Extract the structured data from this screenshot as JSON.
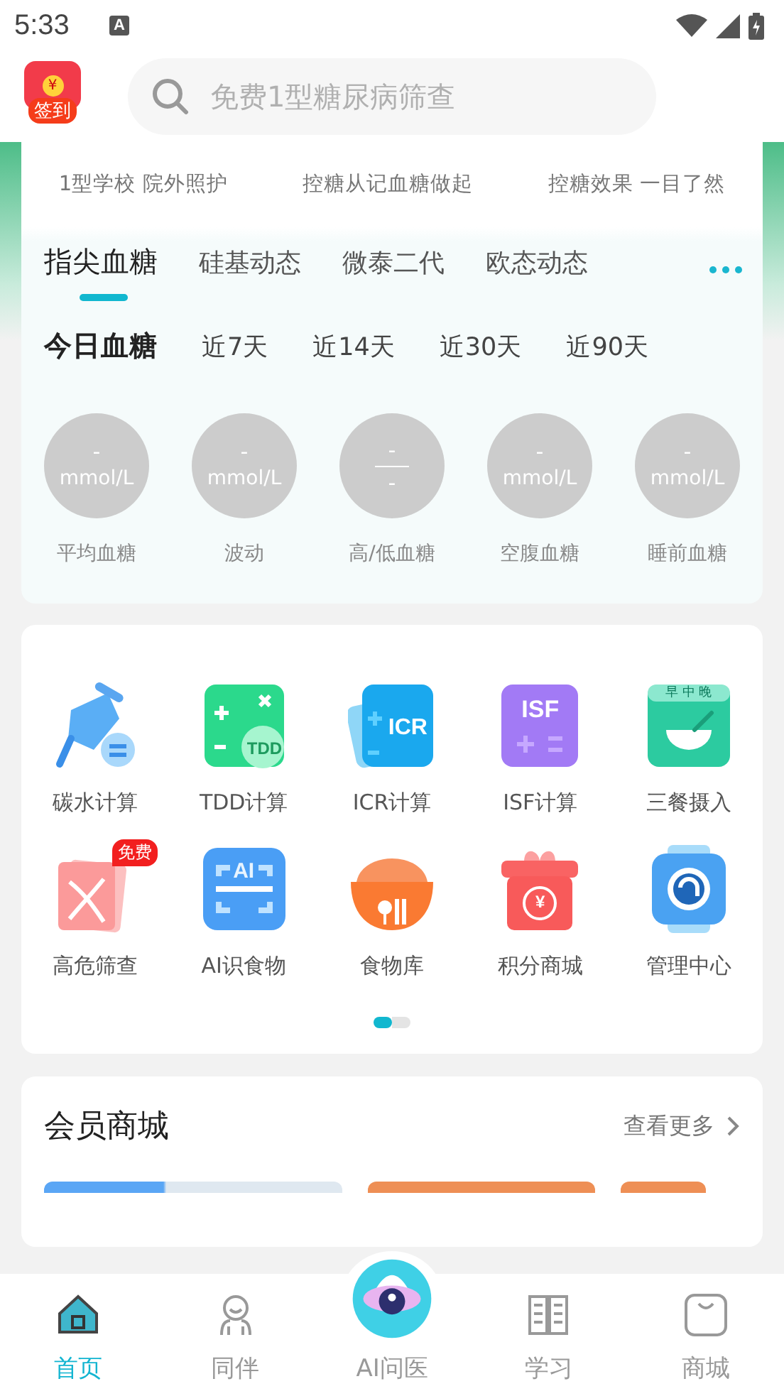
{
  "status_bar": {
    "time": "5:33",
    "notice_letter": "A"
  },
  "header": {
    "signin": {
      "label": "签到",
      "coin": "¥"
    },
    "search": {
      "placeholder": "免费1型糖尿病筛查"
    }
  },
  "features": [
    {
      "subtitle": "1型学校 院外照护"
    },
    {
      "subtitle": "控糖从记血糖做起"
    },
    {
      "subtitle": "控糖效果 一目了然"
    }
  ],
  "device_tabs": [
    {
      "label": "指尖血糖",
      "selected": true
    },
    {
      "label": "硅基动态",
      "selected": false
    },
    {
      "label": "微泰二代",
      "selected": false
    },
    {
      "label": "欧态动态",
      "selected": false
    }
  ],
  "period_tabs": [
    {
      "label": "今日血糖",
      "selected": true
    },
    {
      "label": "近7天",
      "selected": false
    },
    {
      "label": "近14天",
      "selected": false
    },
    {
      "label": "近30天",
      "selected": false
    },
    {
      "label": "近90天",
      "selected": false
    }
  ],
  "stats": [
    {
      "kind": "single",
      "value": "-",
      "unit": "mmol/L",
      "label": "平均血糖"
    },
    {
      "kind": "single",
      "value": "-",
      "unit": "mmol/L",
      "label": "波动"
    },
    {
      "kind": "fraction",
      "value": "-",
      "value2": "-",
      "label": "高/低血糖"
    },
    {
      "kind": "single",
      "value": "-",
      "unit": "mmol/L",
      "label": "空腹血糖"
    },
    {
      "kind": "single",
      "value": "-",
      "unit": "mmol/L",
      "label": "睡前血糖"
    }
  ],
  "tools": [
    {
      "kind": "funnel",
      "label": "碳水计算"
    },
    {
      "kind": "tdd",
      "label": "TDD计算",
      "icon_text": "TDD"
    },
    {
      "kind": "icr",
      "label": "ICR计算",
      "icon_text": "ICR"
    },
    {
      "kind": "isf",
      "label": "ISF计算",
      "icon_text": "ISF"
    },
    {
      "kind": "meals",
      "label": "三餐摄入",
      "icon_text": "早 中 晚"
    },
    {
      "kind": "dna",
      "label": "高危筛查",
      "badge": "免费"
    },
    {
      "kind": "scan",
      "label": "AI识食物",
      "icon_text": "AI"
    },
    {
      "kind": "food",
      "label": "食物库"
    },
    {
      "kind": "gift",
      "label": "积分商城",
      "icon_text": "¥"
    },
    {
      "kind": "watch",
      "label": "管理中心"
    }
  ],
  "pager": [
    {
      "selected": true
    },
    {
      "selected": false
    }
  ],
  "mall": {
    "title": "会员商城",
    "more": "查看更多"
  },
  "nav": [
    {
      "kind": "home",
      "label": "首页",
      "selected": true
    },
    {
      "kind": "partner",
      "label": "同伴",
      "selected": false
    },
    {
      "kind": "ai",
      "label": "AI问医",
      "selected": false
    },
    {
      "kind": "book",
      "label": "学习",
      "selected": false
    },
    {
      "kind": "bag",
      "label": "商城",
      "selected": false
    }
  ]
}
